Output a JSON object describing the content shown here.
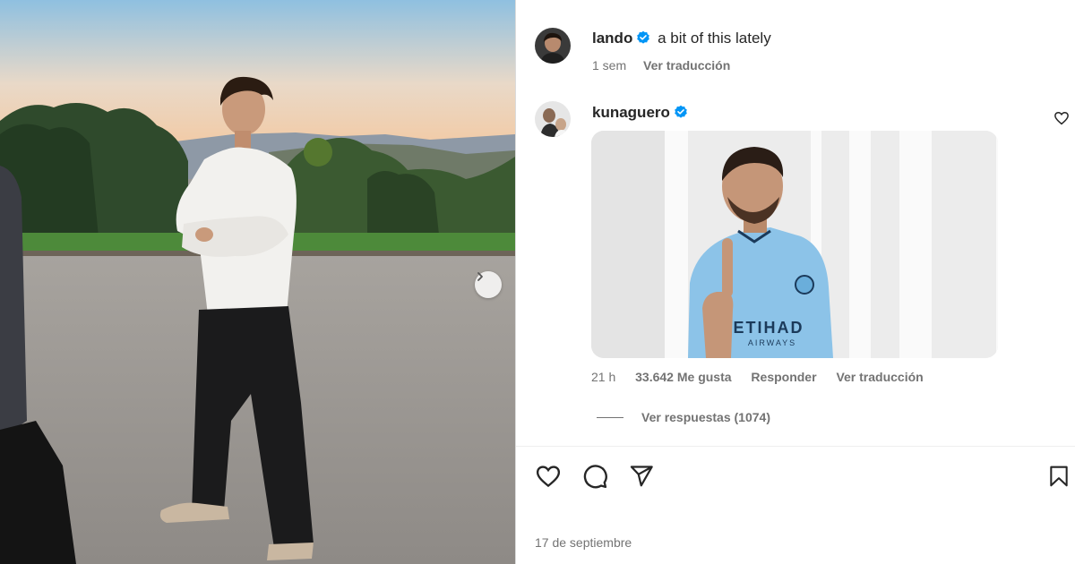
{
  "post": {
    "author": "lando",
    "caption": "a bit of this lately",
    "time_ago": "1 sem",
    "translate_label": "Ver traducción",
    "date": "17 de septiembre"
  },
  "comment": {
    "author": "kunaguero",
    "gif_alt": "GIF of footballer in sky-blue jersey raising one finger",
    "gif_jersey_text": "ETIHAD",
    "gif_jersey_subtext": "AIRWAYS",
    "time_ago": "21 h",
    "likes": "33.642 Me gusta",
    "reply_label": "Responder",
    "translate_label": "Ver traducción",
    "view_replies": "Ver respuestas (1074)"
  },
  "icons": {
    "verified": "verified-badge-icon",
    "like": "heart-icon",
    "comment": "comment-bubble-icon",
    "share": "paper-plane-icon",
    "save": "bookmark-icon",
    "next": "chevron-right-icon"
  },
  "colors": {
    "verified_blue": "#0095f6",
    "text_primary": "#262626",
    "text_secondary": "#737373",
    "jersey_blue": "#8cc3e8"
  }
}
